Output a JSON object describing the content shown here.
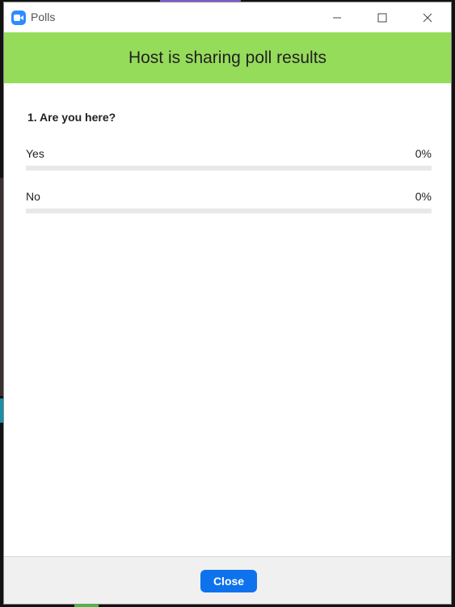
{
  "window": {
    "title": "Polls"
  },
  "banner": {
    "text": "Host is sharing poll results"
  },
  "poll": {
    "question": "1. Are you here?",
    "options": [
      {
        "label": "Yes",
        "percent_label": "0%",
        "fraction": 0
      },
      {
        "label": "No",
        "percent_label": "0%",
        "fraction": 0
      }
    ]
  },
  "footer": {
    "close_label": "Close"
  },
  "colors": {
    "banner": "#96dc5b",
    "accent": "#0e72ed",
    "bar_track": "#e8e8e8"
  },
  "icons": {
    "app": "zoom-camera-icon",
    "minimize": "minimize-icon",
    "maximize": "maximize-icon",
    "close": "close-icon"
  }
}
